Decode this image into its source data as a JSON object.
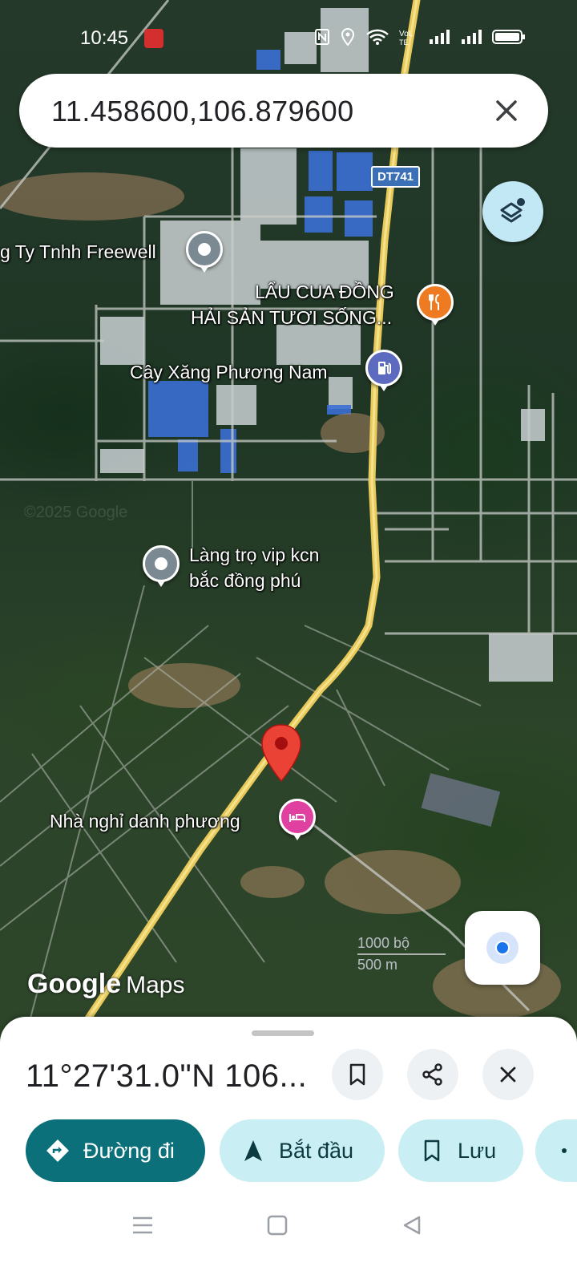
{
  "status_bar": {
    "time": "10:45",
    "icons": [
      "nfc-icon",
      "location-icon",
      "wifi-icon",
      "volte-icon",
      "signal-icon",
      "signal-icon",
      "battery-icon"
    ]
  },
  "search": {
    "query": "11.458600,106.879600"
  },
  "map": {
    "road_shield": "DT741",
    "places": [
      {
        "label": "g Ty Tnhh Freewell",
        "icon": "place-icon"
      },
      {
        "label_line1": "LẨU CUA ĐỒNG",
        "label_line2": "HẢI SẢN TƯƠI SỐNG...",
        "icon": "restaurant-icon"
      },
      {
        "label": "Cây Xăng Phương Nam",
        "icon": "gas-station-icon"
      },
      {
        "label_line1": "Làng trọ vip kcn",
        "label_line2": "bắc đồng phú",
        "icon": "place-icon"
      },
      {
        "label": "Nhà nghỉ danh phương",
        "icon": "hotel-icon"
      }
    ],
    "scale": {
      "feet": "1000 bộ",
      "meters": "500 m"
    },
    "logo_google": "Google",
    "logo_maps": "Maps"
  },
  "sheet": {
    "title": "11°27'31.0\"N 106...",
    "actions": {
      "directions": "Đường đi",
      "start": "Bắt đầu",
      "save": "Lưu"
    }
  },
  "colors": {
    "accent": "#0b7079",
    "chip": "#c9eef3",
    "pin_red": "#ea4335",
    "route_yellow": "#e8c95a"
  }
}
